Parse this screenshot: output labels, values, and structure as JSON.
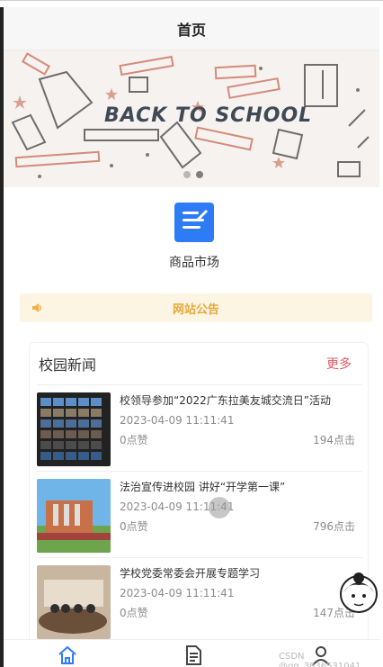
{
  "header": {
    "title": "首页"
  },
  "banner": {
    "text": "BACK TO SCHOOL"
  },
  "grid": {
    "items": [
      {
        "label": "商品市场",
        "icon": "edit-document-icon"
      }
    ]
  },
  "notice": {
    "text": "网站公告",
    "icon": "speaker-icon"
  },
  "news": {
    "title": "校园新闻",
    "more": "更多",
    "items": [
      {
        "text": "校领导参加“2022广东拉美友城交流日”活动",
        "date": "2023-04-09 11:11:41",
        "likes": "0点赞",
        "clicks": "194点击"
      },
      {
        "text": "法治宣传进校园 讲好“开学第一课”",
        "date": "2023-04-09 11:11:41",
        "likes": "0点赞",
        "clicks": "796点击"
      },
      {
        "text": "学校党委常委会开展专题学习",
        "date": "2023-04-09 11:11:41",
        "likes": "0点赞",
        "clicks": "147点击"
      }
    ]
  },
  "tabbar": {
    "items": [
      {
        "icon": "home-icon"
      },
      {
        "icon": "document-icon"
      },
      {
        "icon": "user-icon"
      }
    ]
  },
  "watermark": "CSDN @qq_3836531041",
  "colors": {
    "primary": "#2d7cf6",
    "notice_bg": "#fdf5e3",
    "notice_text": "#e7a93a",
    "more": "#e15b63"
  }
}
